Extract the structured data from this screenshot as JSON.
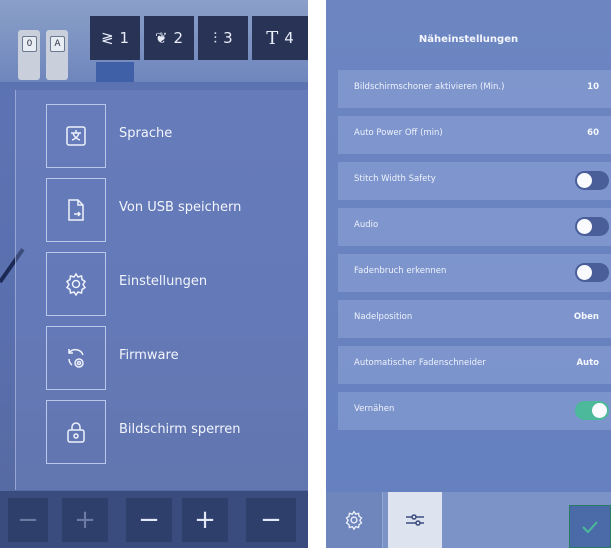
{
  "left_panel": {
    "thumbnails": [
      "0",
      "A"
    ],
    "stitch_tabs": [
      "1",
      "2",
      "3",
      "4"
    ],
    "menu": [
      {
        "label": "Sprache",
        "icon": "language-icon"
      },
      {
        "label": "Von USB speichern",
        "icon": "usb-save-icon"
      },
      {
        "label": "Einstellungen",
        "icon": "settings-gear-icon"
      },
      {
        "label": "Firmware",
        "icon": "firmware-update-icon"
      },
      {
        "label": "Bildschirm sperren",
        "icon": "lock-screen-icon"
      }
    ],
    "bottom_controls": [
      "−",
      "+",
      "−",
      "+",
      "−"
    ]
  },
  "right_panel": {
    "title": "Näheinstellungen",
    "rows": [
      {
        "label": "Bildschirmschoner aktivieren (Min.)",
        "value": "10"
      },
      {
        "label": "Auto Power Off (min)",
        "value": "60"
      },
      {
        "label": "Stitch Width Safety",
        "toggle": "off"
      },
      {
        "label": "Audio",
        "toggle": "off"
      },
      {
        "label": "Fadenbruch erkennen",
        "toggle": "off"
      },
      {
        "label": "Nadelposition",
        "value": "Oben"
      },
      {
        "label": "Automatischer Fadenschneider",
        "value": "Auto"
      },
      {
        "label": "Vernähen",
        "toggle": "on"
      }
    ],
    "bottom_buttons": [
      "settings-gear-icon",
      "sliders-icon",
      "confirm-check-icon"
    ]
  },
  "colors": {
    "accent_toggle_on": "#4bb99a",
    "panel_bg": "#6580bf",
    "dark_tab": "#283356"
  }
}
